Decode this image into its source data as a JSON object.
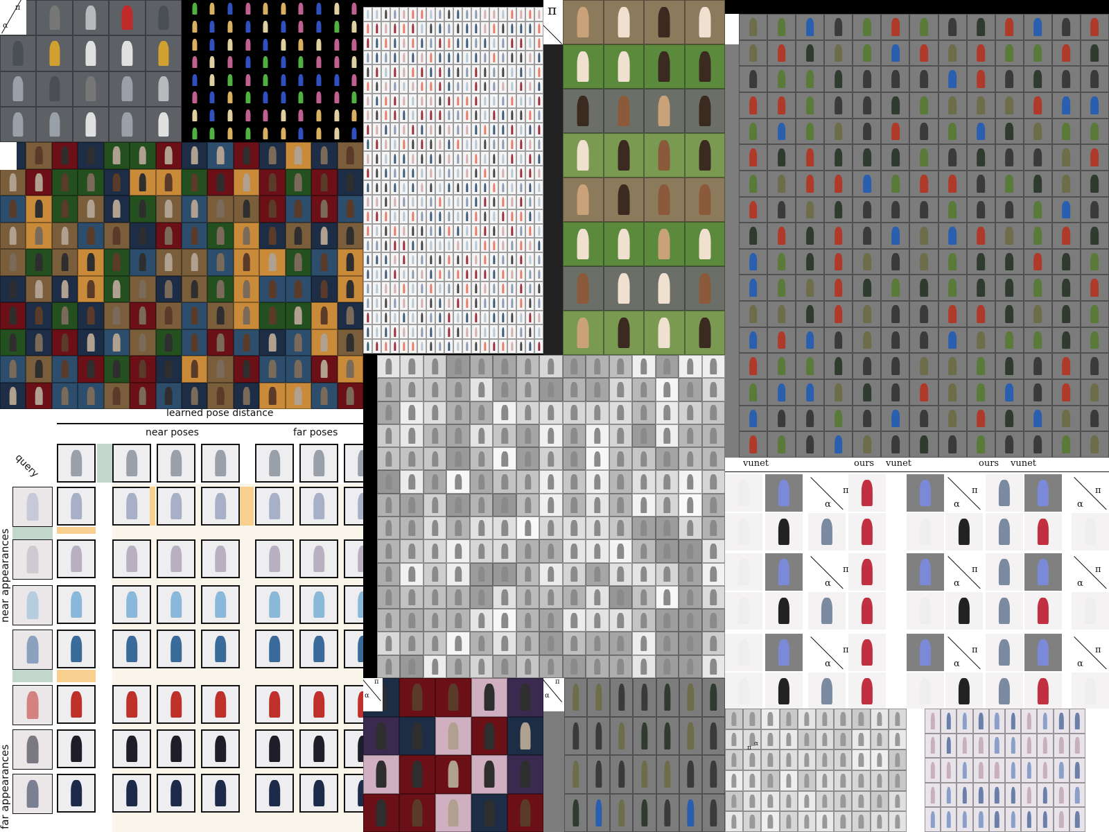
{
  "retrieval": {
    "title": "learned pose distance",
    "near_poses": "near poses",
    "far_poses": "far poses",
    "query": "query",
    "near_appearances": "near appearances",
    "far_appearances": "far appearances"
  },
  "comparison": {
    "headers": [
      "vunet",
      "ours",
      "vunet",
      "ours",
      "vunet"
    ]
  },
  "symbols": {
    "alpha": "α",
    "pi": "π"
  },
  "colors": {
    "pose_gray": "#808080",
    "cream": "#faf5ea",
    "orange": "#f7cf8f",
    "teal": "#c3d6cc",
    "grass": "#5b8a3c",
    "stage_blue": "#1d2d45",
    "stage_red": "#6a1016"
  }
}
